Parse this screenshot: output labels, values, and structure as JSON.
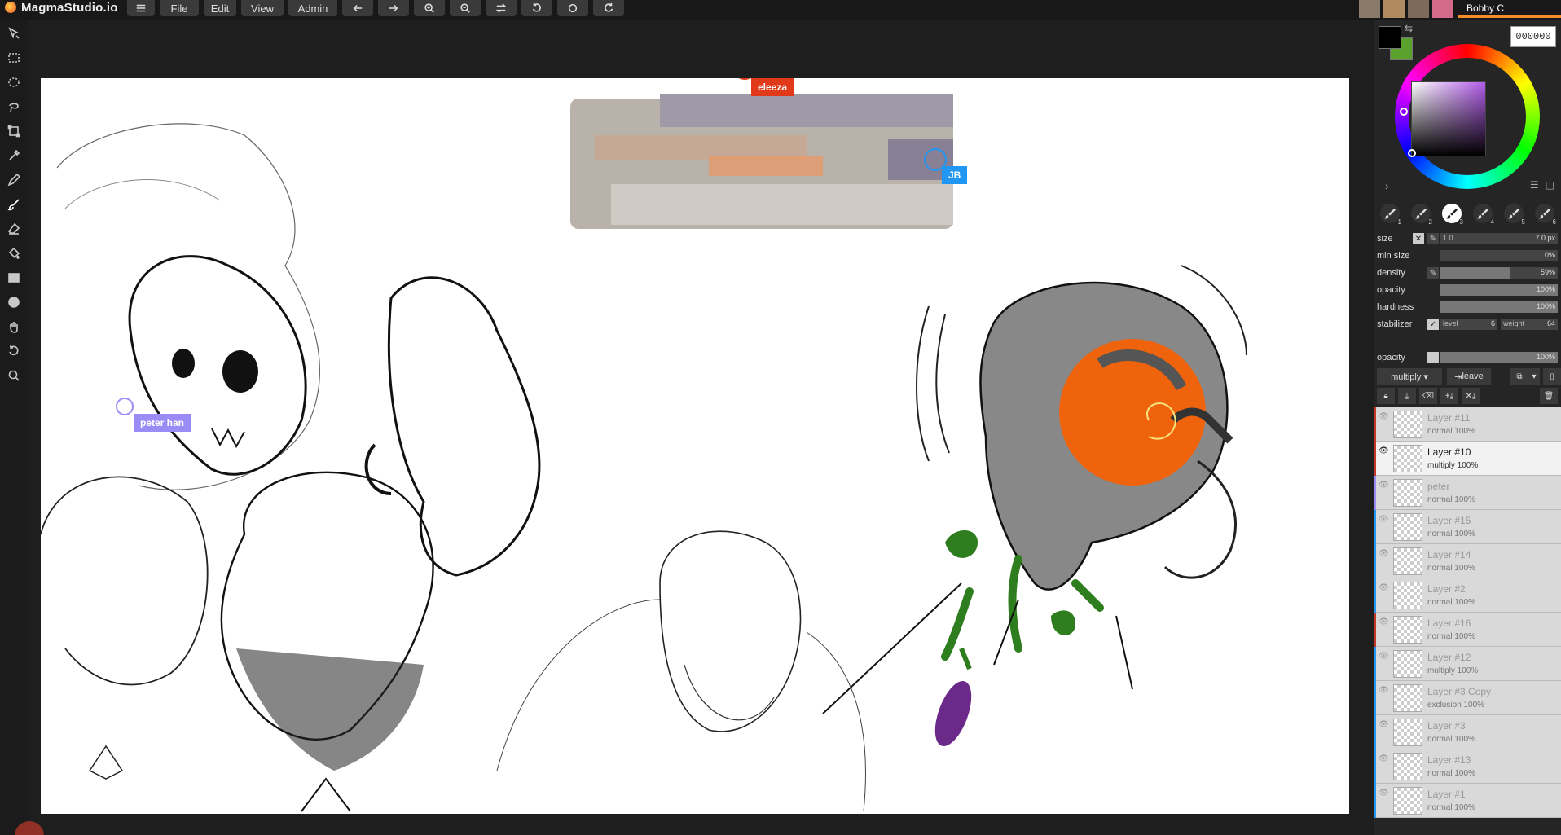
{
  "app": {
    "name": "MagmaStudio.io"
  },
  "menu": {
    "file": "File",
    "edit": "Edit",
    "view": "View",
    "admin": "Admin"
  },
  "toolbar_icons": [
    "hamburger-icon",
    "undo-arrow-icon",
    "redo-arrow-icon",
    "zoom-in-icon",
    "zoom-out-icon",
    "flip-icon",
    "rotate-left-icon",
    "reset-rotate-icon",
    "rotate-right-icon"
  ],
  "users": {
    "current_name": "Bobby C"
  },
  "collaborators": [
    {
      "name": "eleeza",
      "color": "#e03a1a"
    },
    {
      "name": "JB",
      "color": "#2196f3"
    },
    {
      "name": "peter han",
      "color": "#9b8cf5"
    }
  ],
  "color": {
    "hex": "000000",
    "primary": "#000000",
    "secondary": "#5aa12e"
  },
  "brush_slots": [
    "1",
    "2",
    "3",
    "4",
    "5",
    "6"
  ],
  "active_brush": "3",
  "brush_settings": {
    "size_label": "size",
    "size_left": "1.0",
    "size_value": "7.0 px",
    "min_size_label": "min size",
    "min_size_value": "0%",
    "min_size": 0,
    "density_label": "density",
    "density_value": "59%",
    "density": 59,
    "opacity_label": "opacity",
    "opacity_value": "100%",
    "opacity": 100,
    "hardness_label": "hardness",
    "hardness_value": "100%",
    "hardness": 100,
    "stabilizer_label": "stabilizer",
    "stabilizer_level_label": "level",
    "stabilizer_level": "6",
    "stabilizer_weight_label": "weight",
    "stabilizer_weight": "64"
  },
  "layer_settings": {
    "opacity_label": "opacity",
    "opacity_value": "100%",
    "opacity": 100,
    "blend_mode": "multiply ▾",
    "leave_label": "leave"
  },
  "layers": [
    {
      "name": "Layer #11",
      "mode": "normal 100%",
      "selected": false,
      "accent": "#c0392b"
    },
    {
      "name": "Layer #10",
      "mode": "multiply 100%",
      "selected": true,
      "accent": "#c0392b"
    },
    {
      "name": "peter",
      "mode": "normal 100%",
      "selected": false,
      "accent": "#9b8cf5"
    },
    {
      "name": "Layer #15",
      "mode": "normal 100%",
      "selected": false,
      "accent": "#2196f3"
    },
    {
      "name": "Layer #14",
      "mode": "normal 100%",
      "selected": false,
      "accent": "#2196f3"
    },
    {
      "name": "Layer #2",
      "mode": "normal 100%",
      "selected": false,
      "accent": "#2196f3"
    },
    {
      "name": "Layer #16",
      "mode": "normal 100%",
      "selected": false,
      "accent": "#c0392b"
    },
    {
      "name": "Layer #12",
      "mode": "multiply 100%",
      "selected": false,
      "accent": "#2196f3"
    },
    {
      "name": "Layer #3 Copy",
      "mode": "exclusion 100%",
      "selected": false,
      "accent": "#2196f3"
    },
    {
      "name": "Layer #3",
      "mode": "normal 100%",
      "selected": false,
      "accent": "#2196f3"
    },
    {
      "name": "Layer #13",
      "mode": "normal 100%",
      "selected": false,
      "accent": "#2196f3"
    },
    {
      "name": "Layer #1",
      "mode": "normal 100%",
      "selected": false,
      "accent": "#2196f3"
    }
  ]
}
